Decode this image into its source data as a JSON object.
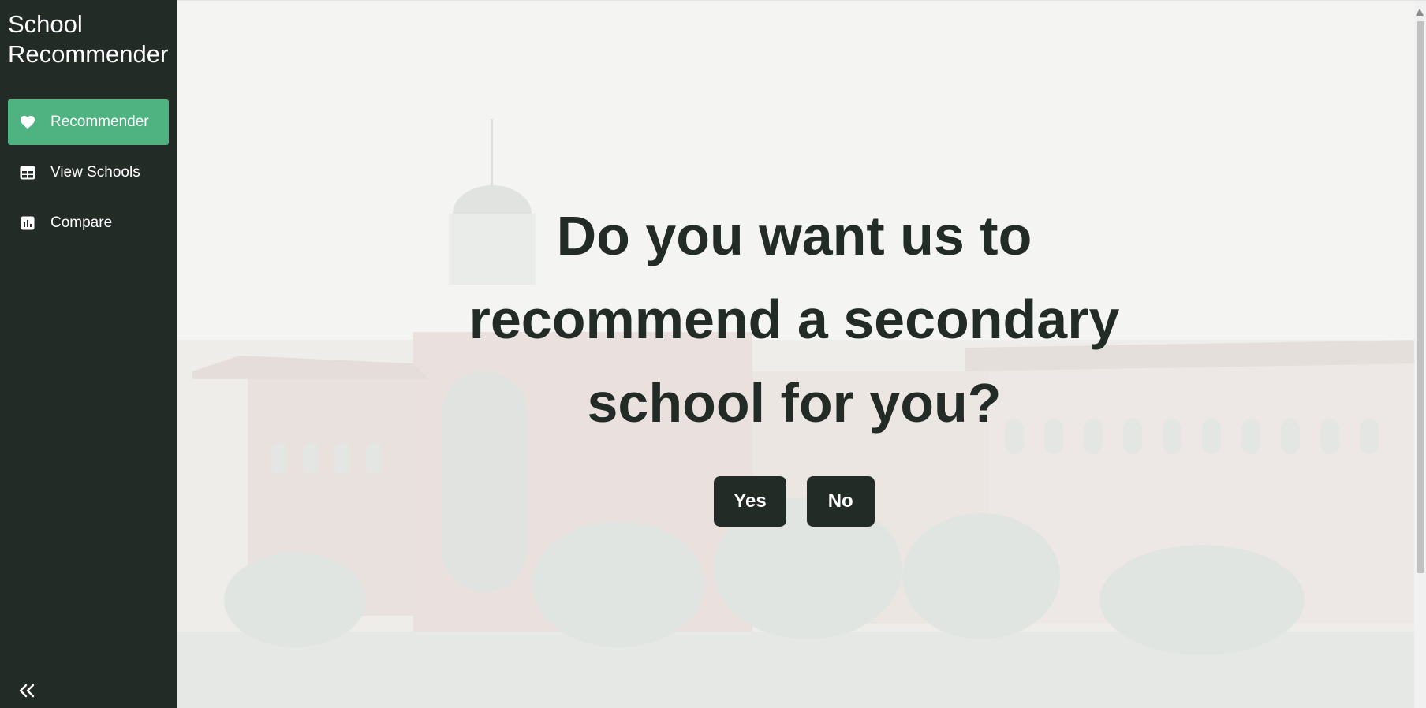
{
  "sidebar": {
    "brand": "School Recommender",
    "items": [
      {
        "label": "Recommender",
        "icon": "heart-icon",
        "active": true
      },
      {
        "label": "View Schools",
        "icon": "table-icon",
        "active": false
      },
      {
        "label": "Compare",
        "icon": "bar-chart-icon",
        "active": false
      }
    ],
    "collapse_icon": "double-chevron-left-icon"
  },
  "main": {
    "headline": "Do you want us to recommend a secondary school for you?",
    "yes_label": "Yes",
    "no_label": "No",
    "background_image": "school building with palm trees"
  },
  "colors": {
    "sidebar_bg": "#232b27",
    "active_item": "#4fb381",
    "button_bg": "#232b27",
    "headline": "#232b27"
  }
}
